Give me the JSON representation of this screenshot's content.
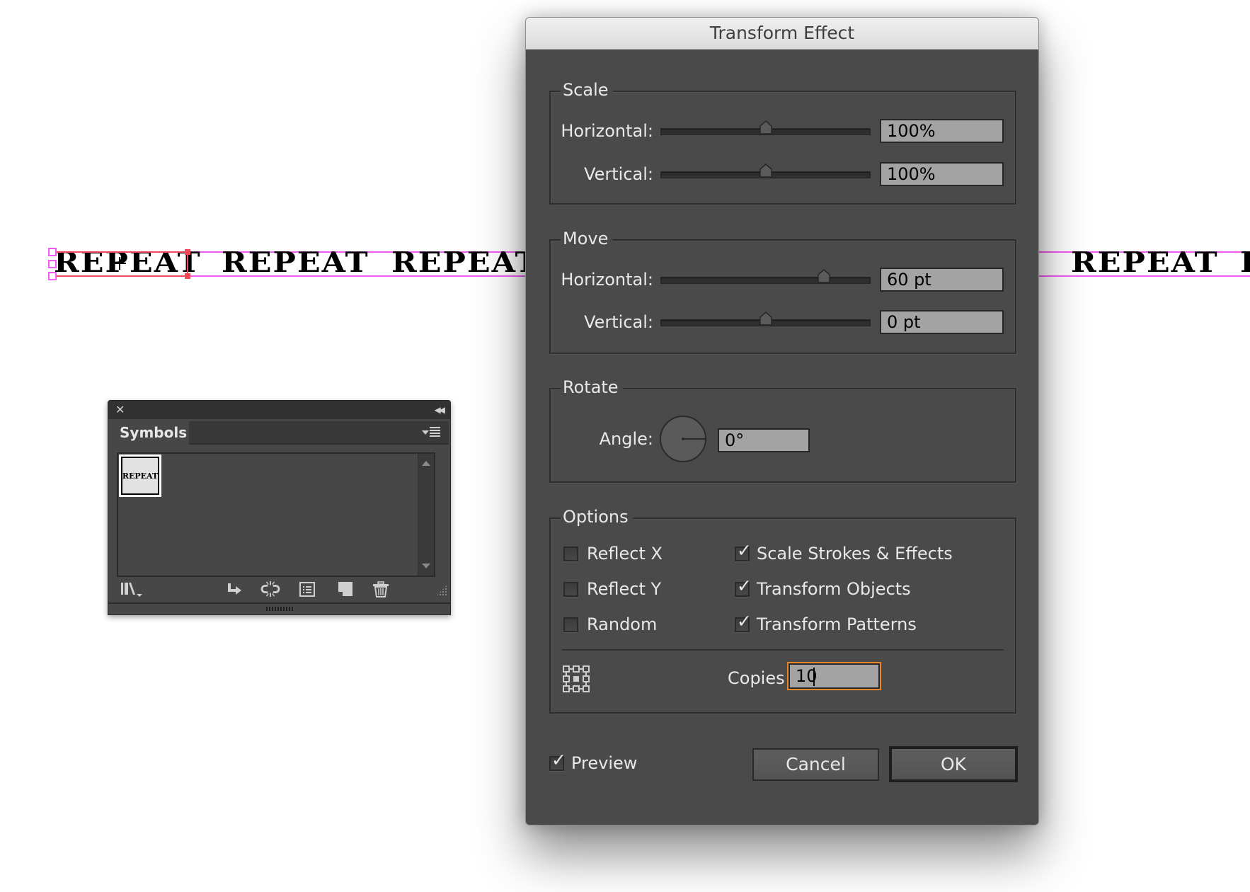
{
  "artboard": {
    "repeat_word": "REPEAT",
    "repeat_word_partial": "R",
    "selection_color": "#f25cf2",
    "bounding_color": "#f04a5a"
  },
  "symbols_panel": {
    "close_icon": "close-icon",
    "collapse_icon": "double-chevron-left-icon",
    "tab_label": "Symbols",
    "menu_icon": "panel-menu-icon",
    "symbols": [
      {
        "name": "REPEAT",
        "selected": true
      }
    ],
    "toolbar_icons": [
      "symbol-libraries-menu-icon",
      "place-symbol-instance-icon",
      "break-link-icon",
      "symbol-options-icon",
      "new-symbol-icon",
      "delete-symbol-icon"
    ]
  },
  "dialog": {
    "title": "Transform Effect",
    "scale": {
      "legend": "Scale",
      "horizontal_label": "Horizontal:",
      "horizontal_value": "100%",
      "horizontal_slider_fraction": 0.5,
      "vertical_label": "Vertical:",
      "vertical_value": "100%",
      "vertical_slider_fraction": 0.5
    },
    "move": {
      "legend": "Move",
      "horizontal_label": "Horizontal:",
      "horizontal_value": "60 pt",
      "horizontal_slider_fraction": 0.78,
      "vertical_label": "Vertical:",
      "vertical_value": "0 pt",
      "vertical_slider_fraction": 0.5
    },
    "rotate": {
      "legend": "Rotate",
      "angle_label": "Angle:",
      "angle_value": "0°"
    },
    "options": {
      "legend": "Options",
      "checkboxes": [
        {
          "label": "Reflect X",
          "checked": false
        },
        {
          "label": "Reflect Y",
          "checked": false
        },
        {
          "label": "Random",
          "checked": false
        },
        {
          "label": "Scale Strokes & Effects",
          "checked": true
        },
        {
          "label": "Transform Objects",
          "checked": true
        },
        {
          "label": "Transform Patterns",
          "checked": true
        }
      ],
      "reference_point_icon": "reference-point-locator-icon",
      "copies_label": "Copies",
      "copies_value": "10",
      "focus_color": "#e8862a"
    },
    "preview": {
      "label": "Preview",
      "checked": true
    },
    "cancel_label": "Cancel",
    "ok_label": "OK"
  }
}
